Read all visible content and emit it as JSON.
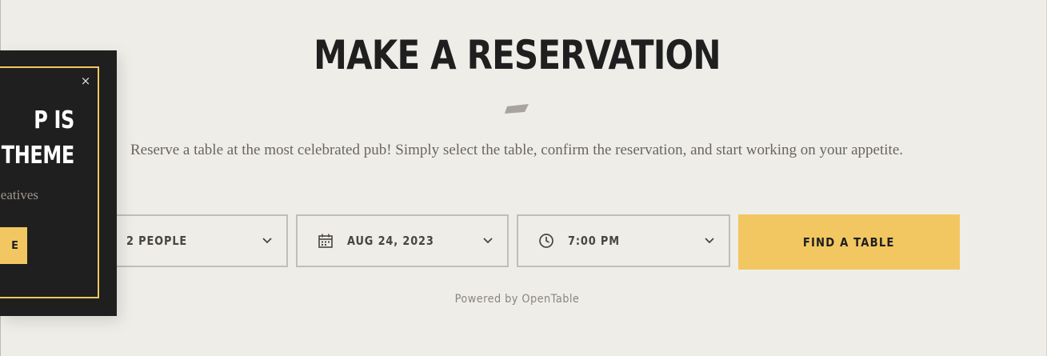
{
  "reservation": {
    "title": "MAKE A RESERVATION",
    "description": "Reserve a table at the most celebrated pub! Simply select the table, confirm the reservation, and start working on your appetite.",
    "party_size": "2 PEOPLE",
    "date": "AUG 24, 2023",
    "time": "7:00 PM",
    "find_button": "FIND A TABLE",
    "powered_by": "Powered by OpenTable"
  },
  "popup": {
    "headline_line1": "P IS",
    "headline_line2": "E THEME",
    "subtitle": "eatives",
    "button_label": "E",
    "close_symbol": "×"
  },
  "colors": {
    "background": "#efede8",
    "accent": "#f2c761",
    "dark": "#1f1f1f",
    "text_muted": "#6a6560"
  }
}
